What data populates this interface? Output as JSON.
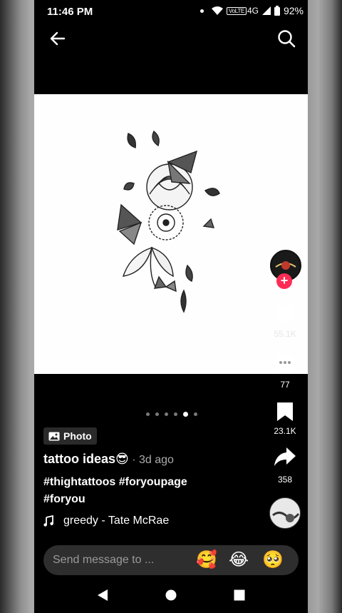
{
  "status": {
    "time": "11:46 PM",
    "network": "4G",
    "volte": "VoLTE",
    "battery": "92%"
  },
  "nav": {
    "back_icon": "arrow-left-icon",
    "search_icon": "search-icon"
  },
  "post": {
    "badge_label": "Photo",
    "title": "tattoo ideas😎",
    "age": " · 3d ago",
    "hashtags_line1": "#thightattoos #foryoupage",
    "hashtags_line2": "#foryou",
    "sound": "greedy - Tate McRae",
    "slide_count": 6,
    "active_slide": 5
  },
  "rail": {
    "likes": "55.1K",
    "comments": "77",
    "saves": "23.1K",
    "shares": "358"
  },
  "message": {
    "placeholder": "Send message to ...",
    "emoji_1": "🥰",
    "emoji_2": "😂",
    "emoji_3": "🥺"
  },
  "colors": {
    "accent": "#fe2c55",
    "background": "#000000",
    "muted_text": "#aaaaaa"
  }
}
